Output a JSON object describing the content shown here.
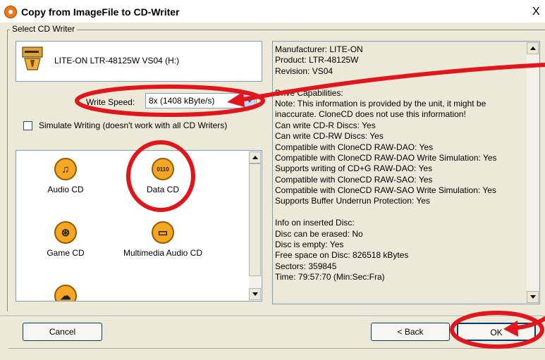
{
  "window": {
    "title": "Copy from ImageFile to CD-Writer",
    "close_glyph": "X",
    "icon": "clonecd-app-icon"
  },
  "group": {
    "legend": "Select CD Writer"
  },
  "drive": {
    "label": "LITE-ON LTR-48125W VS04 (H:)",
    "icon": "cd-drive-icon"
  },
  "write_speed": {
    "label": "Write Speed:",
    "value": "8x (1408 kByte/s)"
  },
  "simulate": {
    "label": "Simulate Writing (doesn't work with all CD Writers)",
    "checked": false
  },
  "profiles": [
    {
      "label": "Audio CD",
      "icon": "music-note-icon",
      "glyph": "♫"
    },
    {
      "label": "Data CD",
      "icon": "binary-data-icon",
      "glyph": "0110"
    },
    {
      "label": "Game CD",
      "icon": "game-disc-icon",
      "glyph": "⊛"
    },
    {
      "label": "Multimedia Audio CD",
      "icon": "monitor-icon",
      "glyph": "▭"
    },
    {
      "label": "",
      "icon": "protected-disc-icon",
      "glyph": "☁"
    }
  ],
  "info": {
    "lines": [
      "Manufacturer: LITE-ON",
      "Product: LTR-48125W",
      "Revision: VS04",
      "",
      "Drive Capabilities:",
      "Note: This information is provided by the unit, it might be",
      "inaccurate. CloneCD does not use this information!",
      "Can write CD-R Discs: Yes",
      "Can write CD-RW Discs: Yes",
      "Compatible with CloneCD RAW-DAO: Yes",
      "Compatible with CloneCD RAW-DAO Write Simulation: Yes",
      "Supports writing of CD+G RAW-DAO: Yes",
      "Compatible with CloneCD RAW-SAO: Yes",
      "Compatible with CloneCD RAW-SAO Write Simulation: Yes",
      "Supports Buffer Underrun Protection: Yes",
      "",
      "Info on inserted Disc:",
      "Disc can be erased: No",
      "Disc is empty: Yes",
      "Free space on Disc: 826518 kBytes",
      "Sectors: 359845",
      "Time: 79:57:70 (Min:Sec:Fra)"
    ]
  },
  "buttons": {
    "cancel": "Cancel",
    "back": "< Back",
    "ok": "OK"
  },
  "annotation_color": "#e0161c"
}
